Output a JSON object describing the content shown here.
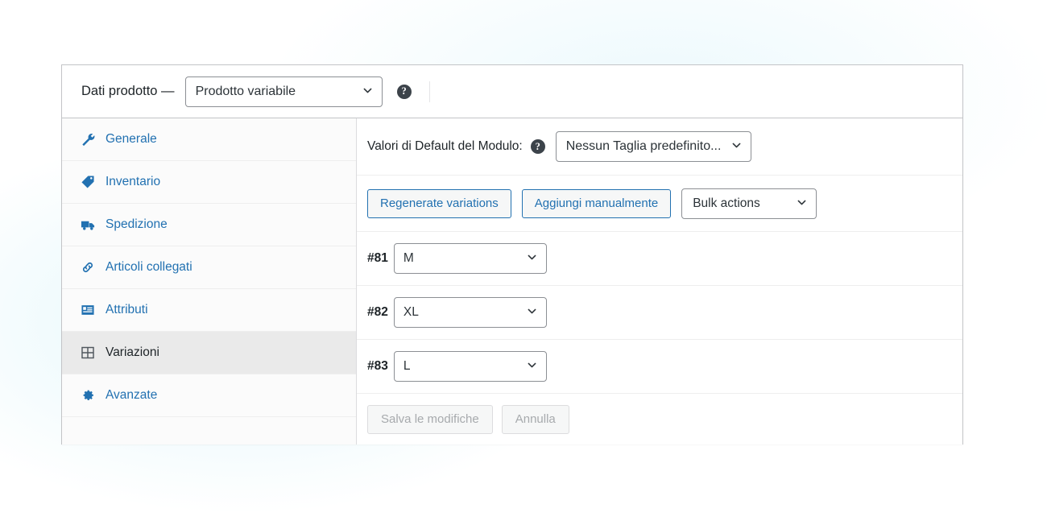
{
  "panel": {
    "title": "Dati prodotto —",
    "product_type": "Prodotto variabile",
    "help_icon_glyph": "?",
    "type_options": [
      "Prodotto variabile"
    ]
  },
  "tabs": [
    {
      "label": "Generale",
      "icon": "wrench-icon",
      "active": false
    },
    {
      "label": "Inventario",
      "icon": "tag-icon",
      "active": false
    },
    {
      "label": "Spedizione",
      "icon": "truck-icon",
      "active": false
    },
    {
      "label": "Articoli collegati",
      "icon": "link-icon",
      "active": false
    },
    {
      "label": "Attributi",
      "icon": "list-card-icon",
      "active": false
    },
    {
      "label": "Variazioni",
      "icon": "grid-icon",
      "active": true
    },
    {
      "label": "Avanzate",
      "icon": "gear-icon",
      "active": false
    }
  ],
  "defaults": {
    "label": "Valori di Default del Modulo:",
    "help_icon_glyph": "?",
    "selected": "Nessun Taglia predefinito...",
    "options": [
      "Nessun Taglia predefinito..."
    ]
  },
  "toolbar": {
    "regenerate_label": "Regenerate variations",
    "add_manually_label": "Aggiungi manualmente",
    "bulk_selected": "Bulk actions",
    "bulk_options": [
      "Bulk actions"
    ]
  },
  "variations": [
    {
      "id": "#81",
      "value": "M",
      "options": [
        "M"
      ]
    },
    {
      "id": "#82",
      "value": "XL",
      "options": [
        "XL"
      ]
    },
    {
      "id": "#83",
      "value": "L",
      "options": [
        "L"
      ]
    }
  ],
  "actions": {
    "save_label": "Salva le modifiche",
    "cancel_label": "Annulla"
  },
  "colors": {
    "link_blue": "#2271b1",
    "text_dark": "#1d2327",
    "border_gray": "#c3c4c7",
    "active_tab_bg": "#eaeaea",
    "glow": "#cdf0f8"
  }
}
